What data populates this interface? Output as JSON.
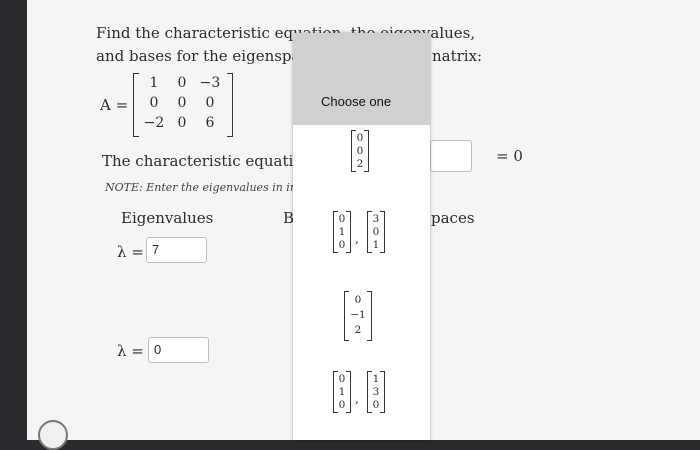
{
  "question": {
    "line1": "Find the characteristic equation, the eigenvalues,",
    "line2_left": "and bases for the eigenspac",
    "line2_right": "natrix:"
  },
  "matrix": {
    "label": "A =",
    "rows": [
      [
        "1",
        "0",
        "−3"
      ],
      [
        "0",
        "0",
        "0"
      ],
      [
        "−2",
        "0",
        "6"
      ]
    ]
  },
  "characteristic": {
    "label": "The characteristic equation",
    "equals": "= 0",
    "note": "NOTE: Enter the eigenvalues in in"
  },
  "eigen": {
    "header_left": "Eigenvalues",
    "header_b": "B",
    "header_right": "paces",
    "lambda1_label": "λ =",
    "lambda1_value": "7",
    "lambda2_label": "λ =",
    "lambda2_value": "0"
  },
  "popup": {
    "title": "Choose one",
    "options": [
      {
        "vectors": [
          [
            "0",
            "0",
            "2"
          ]
        ]
      },
      {
        "vectors": [
          [
            "0",
            "1",
            "0"
          ],
          [
            "3",
            "0",
            "1"
          ]
        ]
      },
      {
        "vectors": [
          [
            "0",
            "−1",
            "2"
          ]
        ]
      },
      {
        "vectors": [
          [
            "0",
            "1",
            "0"
          ],
          [
            "1",
            "3",
            "0"
          ]
        ]
      }
    ]
  }
}
